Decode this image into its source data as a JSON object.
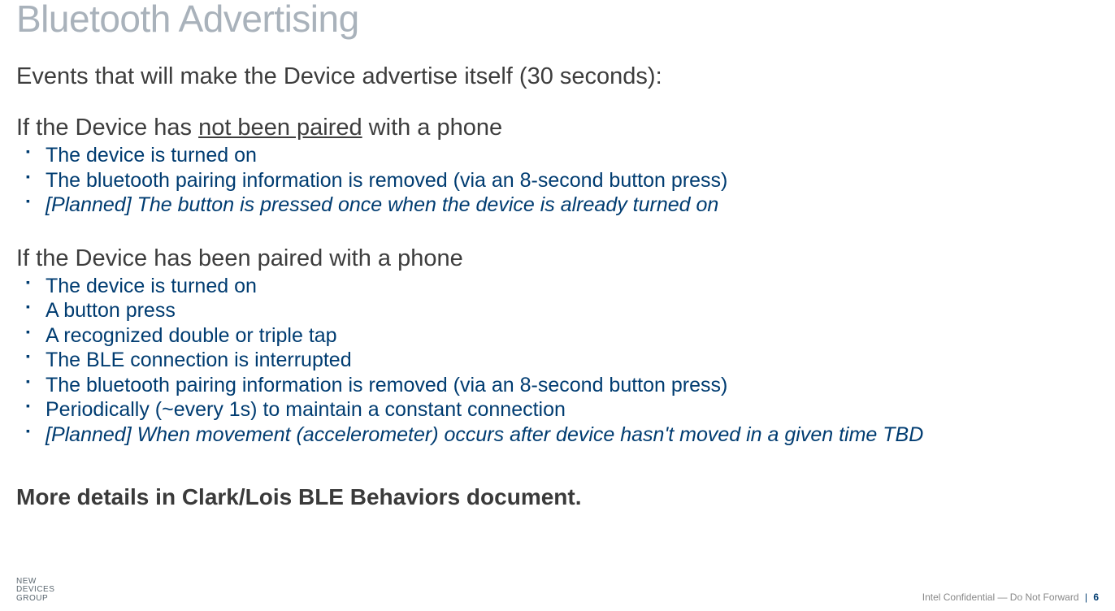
{
  "title": "Bluetooth Advertising",
  "intro": "Events that will make the Device advertise itself (30 seconds):",
  "section1_head_pre": "If the Device has ",
  "section1_head_underline": "not been paired",
  "section1_head_post": " with a phone",
  "section1_items": {
    "0": "The device is turned on",
    "1": "The bluetooth pairing information is removed (via an 8-second button press)",
    "2": "[Planned] The button is pressed once when the device is already turned on"
  },
  "section2_head": "If the Device has been paired with a phone",
  "section2_items": {
    "0": "The device is turned on",
    "1": "A button press",
    "2": "A recognized double or triple tap",
    "3": "The BLE connection is interrupted",
    "4": "The bluetooth pairing information is removed (via an 8-second button press)",
    "5": "Periodically (~every 1s) to maintain a constant connection",
    "6": "[Planned] When movement (accelerometer) occurs after device hasn't moved in a given time TBD"
  },
  "bold_line": "More details in Clark/Lois BLE Behaviors document.",
  "footer_brand_line1": "NEW",
  "footer_brand_line2": "DEVICES",
  "footer_brand_line3": "GROUP",
  "footer_conf": "Intel Confidential — Do Not Forward",
  "footer_sep": "|",
  "footer_page": "6"
}
